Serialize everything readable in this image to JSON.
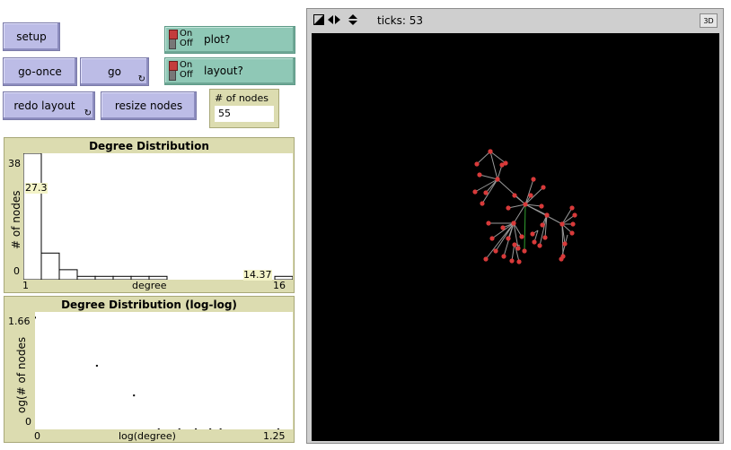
{
  "buttons": {
    "setup": "setup",
    "go_once": "go-once",
    "go": "go",
    "redo_layout": "redo layout",
    "resize_nodes": "resize nodes",
    "forever_glyph": "↻"
  },
  "switches": {
    "on_label": "On",
    "off_label": "Off",
    "plot": {
      "label": "plot?",
      "state": "on"
    },
    "layout": {
      "label": "layout?",
      "state": "on"
    }
  },
  "monitor": {
    "label": "# of nodes",
    "value": "55"
  },
  "plot_linear": {
    "title": "Degree Distribution",
    "ylabel": "# of nodes",
    "xlabel": "degree",
    "ymax_label": "38",
    "ymin_label": "0",
    "xmin_label": "1",
    "xmax_label": "16",
    "cursor_y_label": "27.3",
    "cursor_x_label": "14.37",
    "chart_data": {
      "type": "bar",
      "xlabel": "degree",
      "ylabel": "# of nodes",
      "xlim": [
        1,
        16
      ],
      "ylim": [
        0,
        38
      ],
      "categories": [
        1,
        2,
        3,
        4,
        5,
        6,
        7,
        8,
        9,
        10,
        11,
        12,
        13,
        14,
        15
      ],
      "values": [
        38,
        8,
        3,
        1,
        1,
        1,
        1,
        1,
        0,
        0,
        0,
        0,
        0,
        0,
        1
      ]
    }
  },
  "plot_loglog": {
    "title": "Degree Distribution (log-log)",
    "ylabel": "log(# of nodes)",
    "ylabel_visible": "og(# of nodes",
    "xlabel": "log(degree)",
    "ymax_label": "1.66",
    "ymin_label": "0",
    "xmin_label": "0",
    "xmax_label": "1.25",
    "chart_data": {
      "type": "scatter",
      "xlabel": "log(degree)",
      "ylabel": "log(# of nodes)",
      "xlim": [
        0,
        1.25
      ],
      "ylim": [
        0,
        1.66
      ],
      "x": [
        0,
        0.3,
        0.48,
        0.6,
        0.7,
        0.78,
        0.85,
        0.9,
        1.18
      ],
      "y": [
        1.58,
        0.9,
        0.48,
        0,
        0,
        0,
        0,
        0,
        0
      ]
    }
  },
  "view": {
    "ticks_label": "ticks: 53",
    "button_3d": "3D",
    "node_color": "#d83a3a",
    "link_color": "#9a9a9a",
    "background": "#000000"
  }
}
